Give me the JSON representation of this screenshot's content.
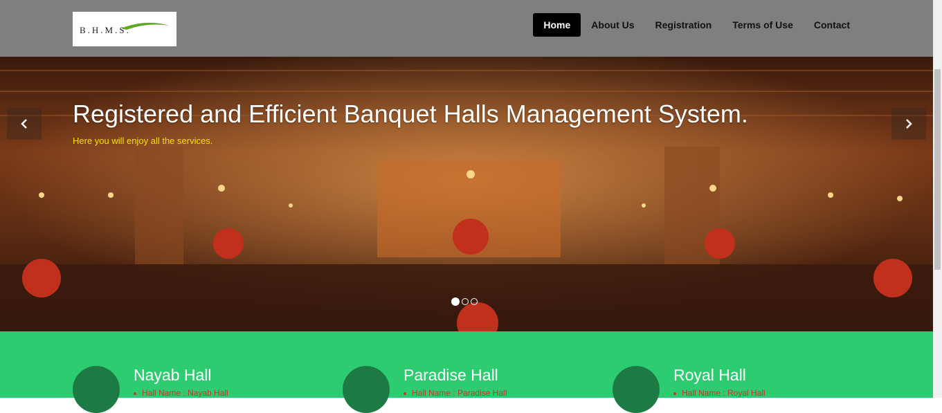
{
  "header": {
    "logo_text": "B.H.M.S.",
    "nav": [
      {
        "label": "Home",
        "active": true
      },
      {
        "label": "About Us",
        "active": false
      },
      {
        "label": "Registration",
        "active": false
      },
      {
        "label": "Terms of Use",
        "active": false
      },
      {
        "label": "Contact",
        "active": false
      }
    ]
  },
  "hero": {
    "title": "Registered and Efficient Banquet Halls Management System.",
    "subtitle": "Here you will enjoy all the services.",
    "prev_icon": "chevron-left-icon",
    "next_icon": "chevron-right-icon",
    "slide_count": 3,
    "active_slide": 1
  },
  "halls": [
    {
      "name": "Nayab Hall",
      "detail": "Hall Name : Nayab Hall"
    },
    {
      "name": "Paradise Hall",
      "detail": "Hall Name : Paradise Hall"
    },
    {
      "name": "Royal Hall",
      "detail": "Hall Name : Royal Hall"
    }
  ],
  "colors": {
    "header_bg": "#7f7f7f",
    "halls_bg": "#2ecc71",
    "hall_circle": "#1e7a45",
    "subtitle": "#f4e100",
    "detail": "#c0392b"
  }
}
